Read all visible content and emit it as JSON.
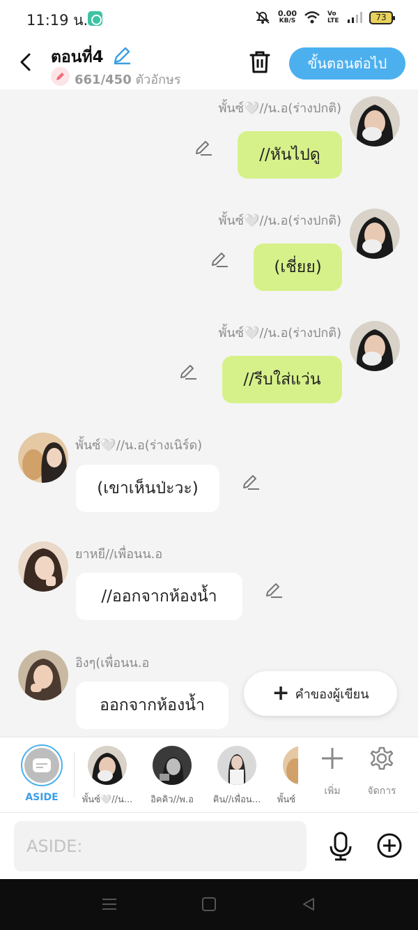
{
  "status_bar": {
    "time": "11:19 น.",
    "speed_value": "0.00",
    "speed_unit": "KB/S",
    "network": "Vo LTE",
    "battery": "73"
  },
  "header": {
    "title": "ตอนที่4",
    "char_count": "661/450",
    "char_unit": "ตัวอักษร",
    "next_button": "ขั้นตอนต่อไป"
  },
  "messages": [
    {
      "side": "right",
      "name": "พั้นซ์🤍//น.อ(ร่างปกติ)",
      "text": "//หันไปดู"
    },
    {
      "side": "right",
      "name": "พั้นซ์🤍//น.อ(ร่างปกติ)",
      "text": "(เชี่ยย)"
    },
    {
      "side": "right",
      "name": "พั้นซ์🤍//น.อ(ร่างปกติ)",
      "text": "//รีบใส่แว่น"
    },
    {
      "side": "left",
      "name": "พั้นซ์🤍//น.อ(ร่างเนิร์ด)",
      "text": "(เขาเห็นป่ะวะ)"
    },
    {
      "side": "left",
      "name": "ยาหยี//เพื่อนน.อ",
      "text": "//ออกจากห้องน้ำ"
    },
    {
      "side": "left",
      "name": "อิงๆ(เพื่อนน.อ",
      "text": "ออกจากห้องน้ำ"
    }
  ],
  "narrator_button": "คำของผู้เขียน",
  "character_bar": {
    "aside_label": "ASIDE",
    "characters": [
      {
        "label": "พั้นซ์🤍//น..."
      },
      {
        "label": "อิคคิว//พ.อ"
      },
      {
        "label": "คิน//เพื่อน..."
      },
      {
        "label": "พั้นซ์"
      }
    ],
    "add_label": "เพิ่ม",
    "manage_label": "จัดการ"
  },
  "input_bar": {
    "placeholder": "ASIDE:"
  },
  "colors": {
    "accent": "#4cb0ef",
    "bubble_right": "#d7f18a",
    "bubble_left": "#ffffff",
    "background": "#f4f4f4"
  }
}
